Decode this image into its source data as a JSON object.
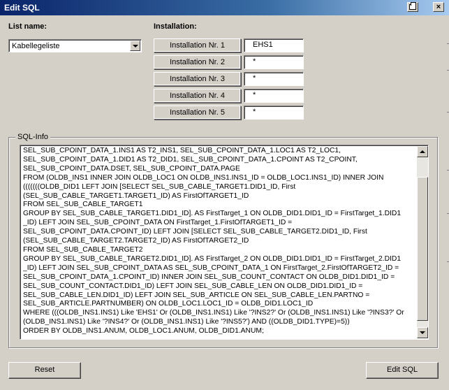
{
  "window": {
    "title": "Edit SQL",
    "print_icon": "printer-icon",
    "close_label": "×"
  },
  "list": {
    "label": "List name:",
    "selected": "Kabellegeliste"
  },
  "installation": {
    "label": "Installation:",
    "rows": [
      {
        "label": "Installation Nr. 1",
        "value": "EHS1"
      },
      {
        "label": "Installation Nr. 2",
        "value": "*"
      },
      {
        "label": "Installation Nr. 3",
        "value": "*"
      },
      {
        "label": "Installation Nr. 4",
        "value": "*"
      },
      {
        "label": "Installation Nr. 5",
        "value": "*"
      }
    ]
  },
  "sql_info": {
    "title": "SQL-Info",
    "text": "SEL_SUB_CPOINT_DATA_1.INS1 AS T2_INS1, SEL_SUB_CPOINT_DATA_1.LOC1 AS T2_LOC1,\nSEL_SUB_CPOINT_DATA_1.DID1 AS T2_DID1, SEL_SUB_CPOINT_DATA_1.CPOINT AS T2_CPOINT,\nSEL_SUB_CPOINT_DATA.DSET, SEL_SUB_CPOINT_DATA.PAGE\nFROM (OLDB_INS1 INNER JOIN OLDB_LOC1 ON OLDB_INS1.INS1_ID = OLDB_LOC1.INS1_ID) INNER JOIN\n(((((((OLDB_DID1 LEFT JOIN [SELECT SEL_SUB_CABLE_TARGET1.DID1_ID, First\n(SEL_SUB_CABLE_TARGET1.TARGET1_ID) AS FirstOfTARGET1_ID\nFROM SEL_SUB_CABLE_TARGET1\nGROUP BY SEL_SUB_CABLE_TARGET1.DID1_ID]. AS FirstTarget_1 ON OLDB_DID1.DID1_ID = FirstTarget_1.DID1\n_ID) LEFT JOIN SEL_SUB_CPOINT_DATA ON FirstTarget_1.FirstOfTARGET1_ID =\nSEL_SUB_CPOINT_DATA.CPOINT_ID) LEFT JOIN [SELECT SEL_SUB_CABLE_TARGET2.DID1_ID, First\n(SEL_SUB_CABLE_TARGET2.TARGET2_ID) AS FirstOfTARGET2_ID\nFROM SEL_SUB_CABLE_TARGET2\nGROUP BY SEL_SUB_CABLE_TARGET2.DID1_ID]. AS FirstTarget_2 ON OLDB_DID1.DID1_ID = FirstTarget_2.DID1\n_ID) LEFT JOIN SEL_SUB_CPOINT_DATA AS SEL_SUB_CPOINT_DATA_1 ON FirstTarget_2.FirstOfTARGET2_ID =\nSEL_SUB_CPOINT_DATA_1.CPOINT_ID) INNER JOIN SEL_SUB_COUNT_CONTACT ON OLDB_DID1.DID1_ID =\nSEL_SUB_COUNT_CONTACT.DID1_ID) LEFT JOIN SEL_SUB_CABLE_LEN ON OLDB_DID1.DID1_ID =\nSEL_SUB_CABLE_LEN.DID1_ID) LEFT JOIN SEL_SUB_ARTICLE ON SEL_SUB_CABLE_LEN.PARTNO =\nSEL_SUB_ARTICLE.PARTNUMBER) ON OLDB_LOC1.LOC1_ID = OLDB_DID1.LOC1_ID\nWHERE (((OLDB_INS1.INS1) Like 'EHS1' Or (OLDB_INS1.INS1) Like '?INS2?' Or (OLDB_INS1.INS1) Like '?INS3?' Or\n(OLDB_INS1.INS1) Like '?INS4?' Or (OLDB_INS1.INS1) Like '?INS5?') AND ((OLDB_DID1.TYPE)=5))\nORDER BY OLDB_INS1.ANUM, OLDB_LOC1.ANUM, OLDB_DID1.ANUM;"
  },
  "buttons": {
    "reset": "Reset",
    "edit_sql": "Edit SQL"
  }
}
